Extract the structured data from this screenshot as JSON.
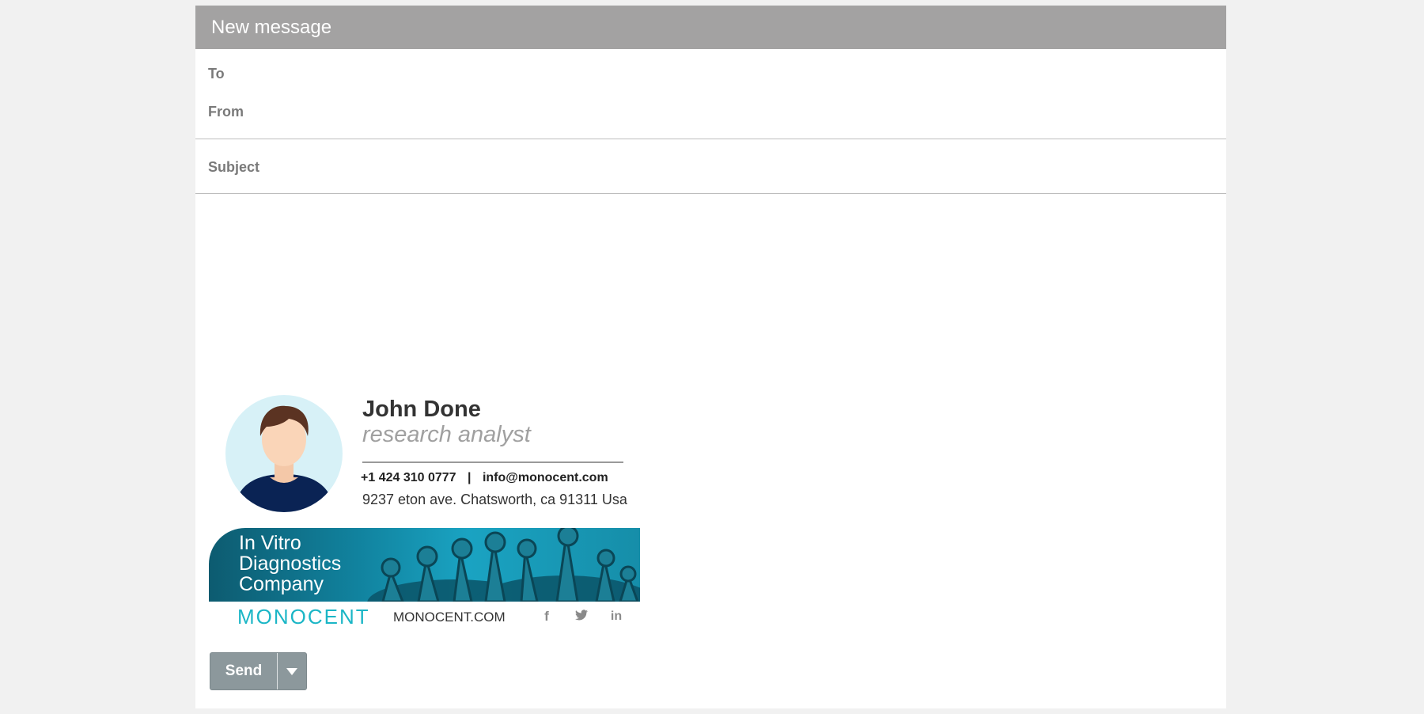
{
  "window": {
    "title": "New message"
  },
  "fields": {
    "to_label": "To",
    "from_label": "From",
    "subject_label": "Subject",
    "to_value": "",
    "from_value": "",
    "subject_value": ""
  },
  "signature": {
    "name": "John Done",
    "role": "research analyst",
    "phone": "+1 424 310 0777",
    "separator": "|",
    "email": "info@monocent.com",
    "address": "9237 eton ave. Chatsworth, ca 91311 Usa",
    "banner_line1": "In Vitro",
    "banner_line2": "Diagnostics",
    "banner_line3": "Company",
    "logo": "MONOCENT",
    "website": "MONOCENT.COM",
    "social": [
      "facebook-icon",
      "twitter-icon",
      "linkedin-icon"
    ]
  },
  "actions": {
    "send_label": "Send",
    "dropdown_icon": "caret-down-icon"
  },
  "colors": {
    "titlebar": "#a3a2a2",
    "send_button": "#8c989c",
    "brand": "#1bb6c6",
    "banner": "#11839f"
  }
}
